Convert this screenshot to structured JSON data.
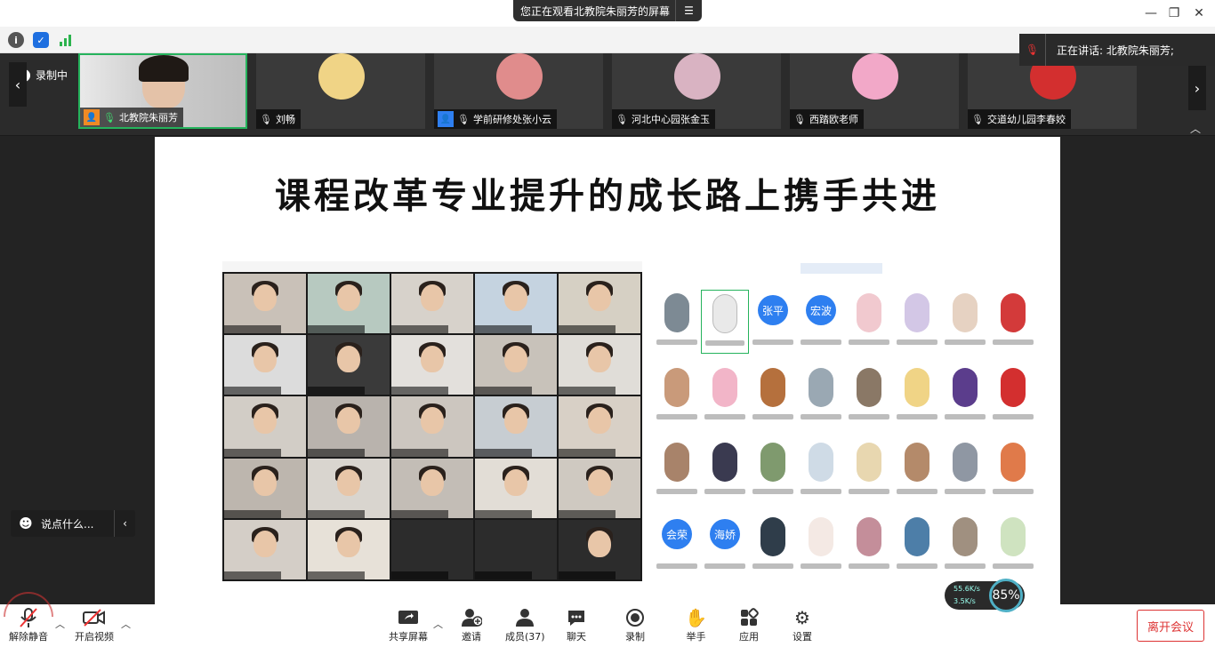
{
  "window": {
    "viewing_text": "您正在观看北教院朱丽芳的屏幕",
    "min": "—",
    "restore": "❐",
    "close": "✕"
  },
  "speaking": {
    "text": "正在讲话: 北教院朱丽芳;"
  },
  "recording": {
    "label": "录制中"
  },
  "participants": [
    {
      "name": "北教院朱丽芳",
      "active": true,
      "color": "#cfd6d9"
    },
    {
      "name": "刘畅",
      "active": false,
      "color": "#f0d486"
    },
    {
      "name": "学前研修处张小云",
      "active": false,
      "color": "#e08c8c"
    },
    {
      "name": "河北中心园张金玉",
      "active": false,
      "color": "#d9b3c2"
    },
    {
      "name": "西踏欧老师",
      "active": false,
      "color": "#f2a8c8"
    },
    {
      "name": "交道幼儿园李春姣",
      "active": false,
      "color": "#d32f2f"
    }
  ],
  "slide": {
    "title": "课程改革专业提升的成长路上携手共进",
    "left_avatars": [
      "张平",
      "宏波"
    ],
    "bottom_avatars": [
      "会荣",
      "海娇"
    ]
  },
  "network": {
    "up": "55.6K/s",
    "down": "3.5K/s",
    "percent": "85%"
  },
  "chat": {
    "placeholder": "说点什么..."
  },
  "toolbar": {
    "unmute": "解除静音",
    "video": "开启视频",
    "share": "共享屏幕",
    "invite": "邀请",
    "members": "成员(37)",
    "chat": "聊天",
    "record": "录制",
    "raise": "举手",
    "apps": "应用",
    "settings": "设置",
    "leave": "离开会议"
  },
  "colors": {
    "accent_green": "#25b35c",
    "leave_red": "#dd3333",
    "brand_blue": "#2e7ff0"
  }
}
